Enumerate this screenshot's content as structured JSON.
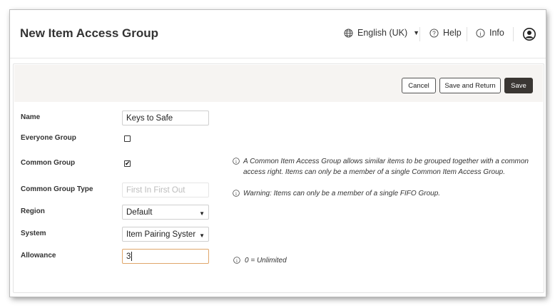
{
  "header": {
    "title": "New Item Access Group",
    "language": "English (UK)",
    "help": "Help",
    "info": "Info"
  },
  "toolbar": {
    "cancel": "Cancel",
    "save_and_return": "Save and Return",
    "save": "Save"
  },
  "form": {
    "name": {
      "label": "Name",
      "value": "Keys to Safe"
    },
    "everyone_group": {
      "label": "Everyone Group",
      "checked": false
    },
    "common_group": {
      "label": "Common Group",
      "checked": true,
      "info": "A Common Item Access Group allows similar items to be grouped together with a common access right. Items can only be a member of a single Common Item Access Group."
    },
    "common_group_type": {
      "label": "Common Group Type",
      "value": "First In First Out",
      "info": "Warning: Items can only be a member of a single FIFO Group."
    },
    "region": {
      "label": "Region",
      "value": "Default"
    },
    "system": {
      "label": "System",
      "value": "Item Pairing Syster"
    },
    "allowance": {
      "label": "Allowance",
      "value": "3",
      "info": "0 = Unlimited"
    }
  },
  "icons": {
    "language": "globe-icon",
    "help": "question-circle-icon",
    "info": "info-circle-icon",
    "user": "user-avatar-icon",
    "checkmark": "✔",
    "caret": "▼"
  }
}
